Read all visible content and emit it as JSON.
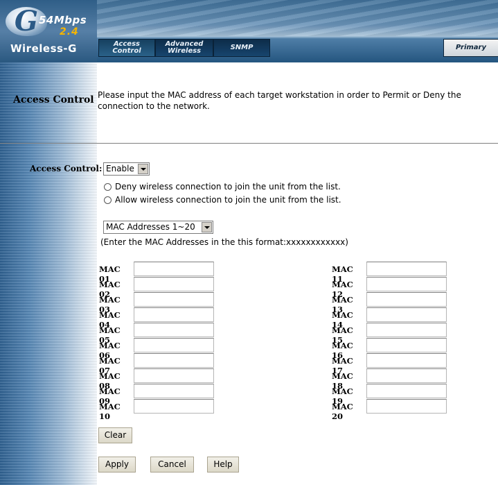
{
  "header": {
    "logo_letter": "G",
    "logo_speed": "54Mbps",
    "logo_band": "2.4",
    "logo_name": "Wireless-G",
    "tabs": [
      {
        "line1": "Access",
        "line2": "Control"
      },
      {
        "line1": "Advanced",
        "line2": "Wireless"
      },
      {
        "line1": "SNMP",
        "line2": ""
      }
    ],
    "primary_tab": "Primary"
  },
  "section": {
    "title": "Access Control",
    "description": "Please input the MAC address of each target workstation in order to Permit or Deny the connection to the network."
  },
  "form": {
    "access_control_label": "Access Control:",
    "access_control_value": "Enable",
    "radio_deny_label": "Deny wireless connection to join the unit from the list.",
    "radio_allow_label": "Allow wireless connection to join the unit from the list.",
    "mac_range_value": "MAC Addresses 1~20",
    "format_note": "(Enter the MAC Addresses in the this format:xxxxxxxxxxxx)",
    "mac_left": [
      "MAC 01",
      "MAC 02",
      "MAC 03",
      "MAC 04",
      "MAC 05",
      "MAC 06",
      "MAC 07",
      "MAC 08",
      "MAC 09",
      "MAC 10"
    ],
    "mac_right": [
      "MAC 11",
      "MAC 12",
      "MAC 13",
      "MAC 14",
      "MAC 15",
      "MAC 16",
      "MAC 17",
      "MAC 18",
      "MAC 19",
      "MAC 20"
    ]
  },
  "buttons": {
    "clear": "Clear",
    "apply": "Apply",
    "cancel": "Cancel",
    "help": "Help"
  }
}
